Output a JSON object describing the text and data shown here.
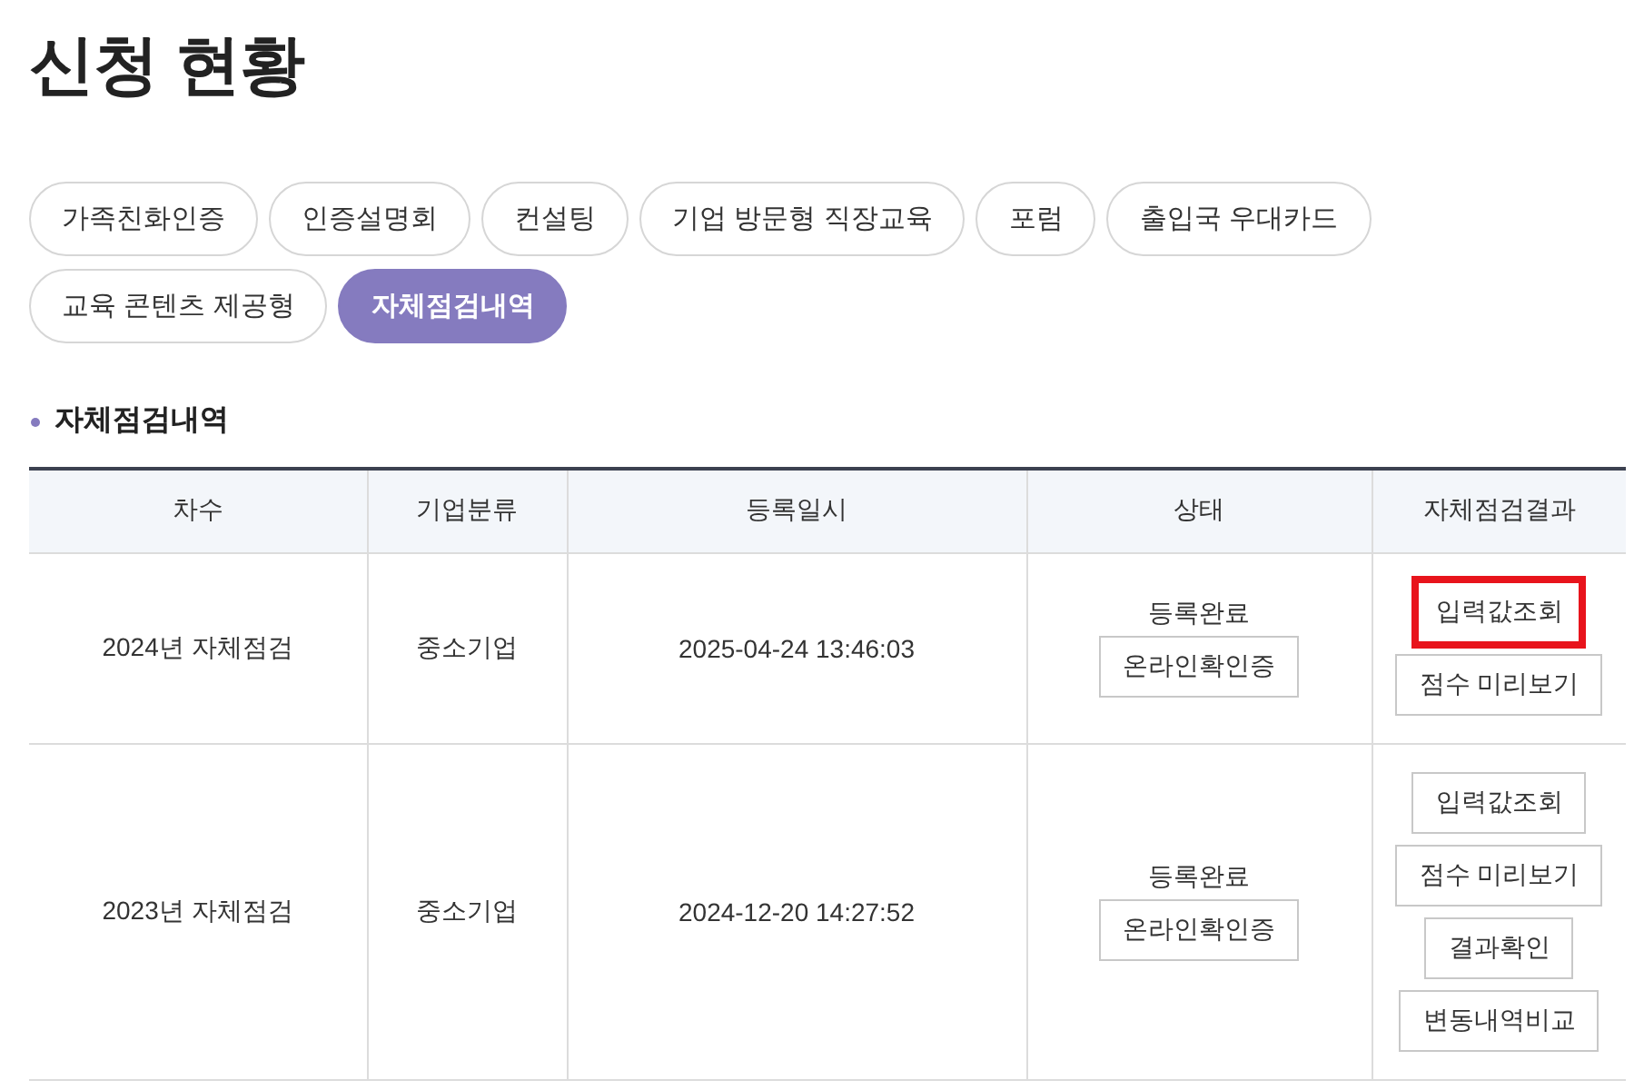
{
  "page_title": "신청 현황",
  "tabs": [
    {
      "label": "가족친화인증",
      "selected": false
    },
    {
      "label": "인증설명회",
      "selected": false
    },
    {
      "label": "컨설팅",
      "selected": false
    },
    {
      "label": "기업 방문형 직장교육",
      "selected": false
    },
    {
      "label": "포럼",
      "selected": false
    },
    {
      "label": "출입국 우대카드",
      "selected": false
    },
    {
      "label": "교육 콘텐츠 제공형",
      "selected": false
    },
    {
      "label": "자체점검내역",
      "selected": true
    }
  ],
  "section": {
    "title": "자체점검내역"
  },
  "table": {
    "columns": [
      "차수",
      "기업분류",
      "등록일시",
      "상태",
      "자체점검결과"
    ],
    "rows": [
      {
        "round": "2024년 자체점검",
        "category": "중소기업",
        "registered_at": "2025-04-24 13:46:03",
        "status": {
          "text": "등록완료",
          "button": "온라인확인증"
        },
        "results": [
          {
            "label": "입력값조회",
            "highlighted": true
          },
          {
            "label": "점수 미리보기",
            "highlighted": false
          }
        ]
      },
      {
        "round": "2023년 자체점검",
        "category": "중소기업",
        "registered_at": "2024-12-20 14:27:52",
        "status": {
          "text": "등록완료",
          "button": "온라인확인증"
        },
        "results": [
          {
            "label": "입력값조회",
            "highlighted": false
          },
          {
            "label": "점수 미리보기",
            "highlighted": false
          },
          {
            "label": "결과확인",
            "highlighted": false
          },
          {
            "label": "변동내역비교",
            "highlighted": false
          }
        ]
      }
    ]
  }
}
